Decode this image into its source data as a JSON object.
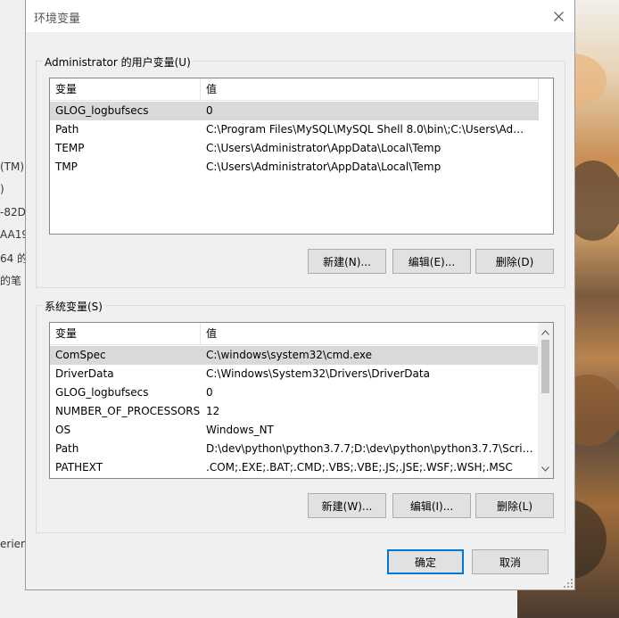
{
  "window": {
    "title": "环境变量",
    "close_label": "×"
  },
  "background_fragments": [
    "(TM)",
    ")",
    "-82D",
    "AA19",
    "64 的",
    "的笔",
    "erien"
  ],
  "user_vars": {
    "group_label": "Administrator 的用户变量(U)",
    "columns": [
      "变量",
      "值"
    ],
    "rows": [
      {
        "name": "GLOG_logbufsecs",
        "value": "0",
        "selected": true
      },
      {
        "name": "Path",
        "value": "C:\\Program Files\\MySQL\\MySQL Shell 8.0\\bin\\;C:\\Users\\Admi..."
      },
      {
        "name": "TEMP",
        "value": "C:\\Users\\Administrator\\AppData\\Local\\Temp"
      },
      {
        "name": "TMP",
        "value": "C:\\Users\\Administrator\\AppData\\Local\\Temp"
      }
    ],
    "buttons": {
      "new": "新建(N)...",
      "edit": "编辑(E)...",
      "delete": "删除(D)"
    }
  },
  "system_vars": {
    "group_label": "系统变量(S)",
    "columns": [
      "变量",
      "值"
    ],
    "rows": [
      {
        "name": "ComSpec",
        "value": "C:\\windows\\system32\\cmd.exe",
        "selected": true
      },
      {
        "name": "DriverData",
        "value": "C:\\Windows\\System32\\Drivers\\DriverData"
      },
      {
        "name": "GLOG_logbufsecs",
        "value": "0"
      },
      {
        "name": "NUMBER_OF_PROCESSORS",
        "value": "12"
      },
      {
        "name": "OS",
        "value": "Windows_NT"
      },
      {
        "name": "Path",
        "value": "D:\\dev\\python\\python3.7.7;D:\\dev\\python\\python3.7.7\\Scripts..."
      },
      {
        "name": "PATHEXT",
        "value": ".COM;.EXE;.BAT;.CMD;.VBS;.VBE;.JS;.JSE;.WSF;.WSH;.MSC"
      }
    ],
    "buttons": {
      "new": "新建(W)...",
      "edit": "编辑(I)...",
      "delete": "删除(L)"
    }
  },
  "footer": {
    "ok": "确定",
    "cancel": "取消"
  }
}
